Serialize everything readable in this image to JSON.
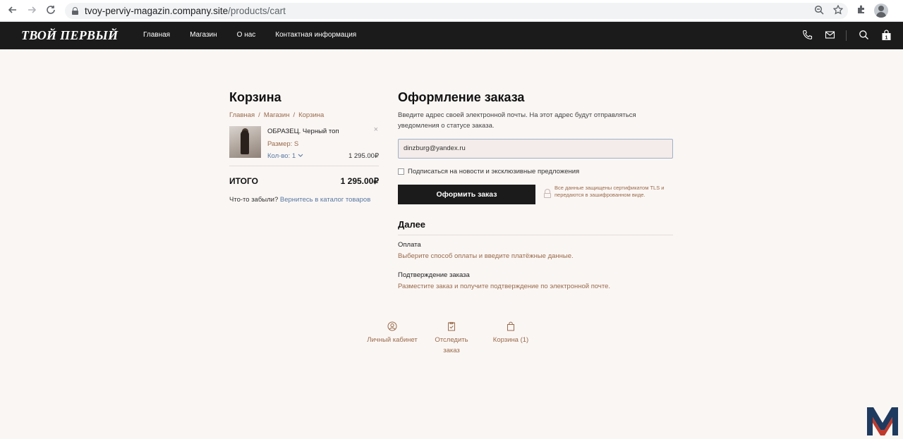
{
  "browser": {
    "url_host": "tvoy-perviy-magazin.company.site",
    "url_path": "/products/cart",
    "back_icon": "arrow-left-icon",
    "forward_icon": "arrow-right-icon",
    "reload_icon": "reload-icon"
  },
  "header": {
    "logo": "ТВОЙ ПЕРВЫЙ",
    "menu": [
      {
        "label": "Главная"
      },
      {
        "label": "Магазин"
      },
      {
        "label": "О нас"
      },
      {
        "label": "Контактная информация"
      }
    ],
    "icons": [
      "phone-icon",
      "mail-icon",
      "search-icon",
      "bag-icon"
    ],
    "bag_count": "1"
  },
  "cart": {
    "title": "Корзина",
    "breadcrumb": [
      "Главная",
      "Магазин",
      "Корзина"
    ],
    "item": {
      "title": "ОБРАЗЕЦ. Черный топ",
      "size": "Размер: S",
      "qty": "Кол-во: 1",
      "price": "1 295.00₽",
      "remove": "×"
    },
    "total_label": "ИТОГО",
    "total_value": "1 295.00₽",
    "forgot_text": "Что-то забыли? ",
    "forgot_link": "Вернитесь в каталог товаров"
  },
  "checkout": {
    "title": "Оформление заказа",
    "intro": "Введите адрес своей электронной почты. На этот адрес будут отправляться уведомления о статусе заказа.",
    "email_value": "dinzburg@yandex.ru",
    "subscribe_label": "Подписаться на новости и эксклюзивные предложения",
    "subscribe_checked": false,
    "order_button": "Оформить заказ",
    "tls_note": "Все данные защищены сертификатом TLS и передаются в зашифрованном виде.",
    "next_title": "Далее",
    "steps": [
      {
        "title": "Оплата",
        "desc": "Выберите способ оплаты и введите платёжные данные."
      },
      {
        "title": "Подтверждение заказа",
        "desc": "Разместите заказ и получите подтверждение по электронной почте."
      }
    ]
  },
  "footer_links": [
    {
      "label": "Личный кабинет",
      "icon": "user-circle-icon"
    },
    {
      "label": "Отследить заказ",
      "icon": "clipboard-check-icon"
    },
    {
      "label": "Корзина (1)",
      "icon": "bag-icon"
    }
  ],
  "colors": {
    "header_bg": "#1b1b1b",
    "page_bg": "#faf6f4",
    "accent_brown": "#9a6a4a",
    "link_blue": "#5878a0",
    "button_bg": "#1b1b1b"
  }
}
